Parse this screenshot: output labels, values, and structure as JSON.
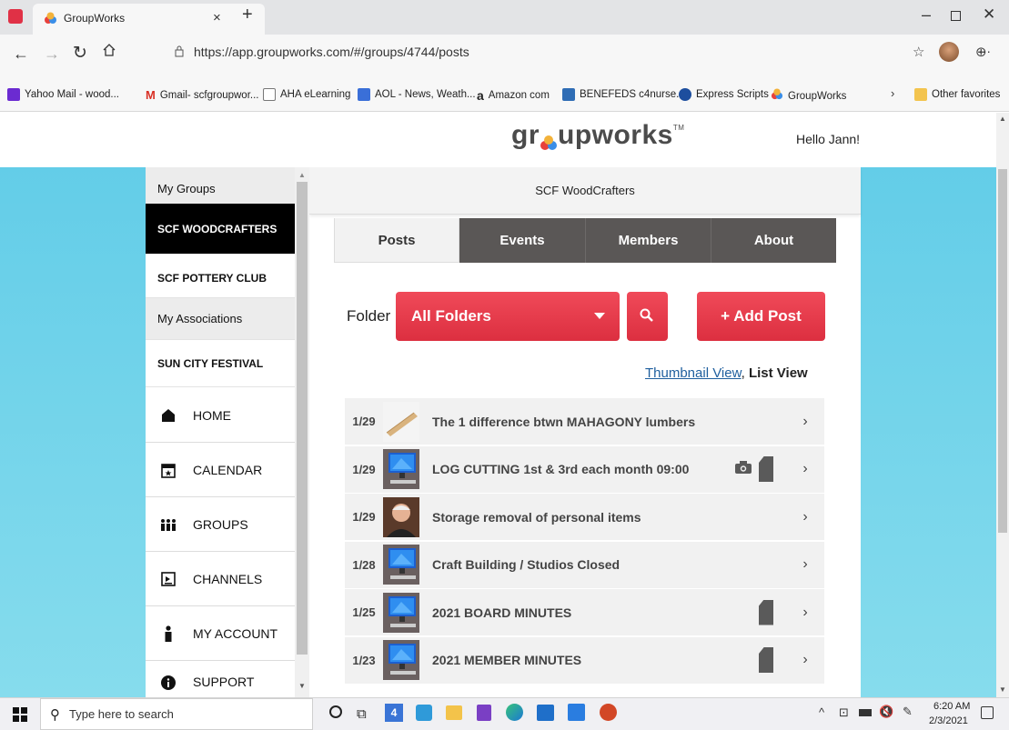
{
  "browser": {
    "tab_title": "GroupWorks",
    "url": "https://app.groupworks.com/#/groups/4744/posts",
    "favorites": [
      {
        "label": "Yahoo Mail - wood...",
        "color": "#6b2bd1"
      },
      {
        "label": "Gmail- scfgroupwor...",
        "color": "#d93025"
      },
      {
        "label": "AHA eLearning",
        "color": "#777777"
      },
      {
        "label": "AOL - News, Weath...",
        "color": "#3a6fd8"
      },
      {
        "label": "Amazon com",
        "color": "#111111"
      },
      {
        "label": "BENEFEDS c4nurse...",
        "color": "#2f6db5"
      },
      {
        "label": "Express Scripts",
        "color": "#1d4e9e"
      },
      {
        "label": "GroupWorks",
        "color": "#f2a33a"
      }
    ],
    "other_favorites": "Other favorites"
  },
  "header": {
    "logo_pre": "gr",
    "logo_post": "upworks",
    "logo_tm": "TM",
    "greeting": "Hello Jann!"
  },
  "sidebar": {
    "my_groups": "My Groups",
    "groups": [
      "SCF WOODCRAFTERS",
      "SCF POTTERY CLUB"
    ],
    "my_associations": "My Associations",
    "associations": [
      "SUN CITY FESTIVAL"
    ],
    "nav": [
      {
        "label": "HOME",
        "icon": "home-icon"
      },
      {
        "label": "CALENDAR",
        "icon": "calendar-icon"
      },
      {
        "label": "GROUPS",
        "icon": "groups-icon"
      },
      {
        "label": "CHANNELS",
        "icon": "channels-icon"
      },
      {
        "label": "MY ACCOUNT",
        "icon": "account-icon"
      },
      {
        "label": "SUPPORT",
        "icon": "info-icon"
      }
    ]
  },
  "main": {
    "group_title": "SCF WoodCrafters",
    "tabs": [
      "Posts",
      "Events",
      "Members",
      "About"
    ],
    "folder_label": "Folder",
    "folder_value": "All Folders",
    "add_post": "+ Add Post",
    "view_thumbnail": "Thumbnail View",
    "view_sep": ",",
    "view_list": "List View",
    "posts": [
      {
        "date": "1/29",
        "title": "The 1 difference btwn MAHAGONY lumbers",
        "thumb": "wood",
        "camera": false,
        "doc": false
      },
      {
        "date": "1/29",
        "title": "LOG CUTTING 1st & 3rd each month 09:00",
        "thumb": "computer",
        "camera": true,
        "doc": true
      },
      {
        "date": "1/29",
        "title": "Storage removal of personal items",
        "thumb": "person",
        "camera": false,
        "doc": false
      },
      {
        "date": "1/28",
        "title": "Craft Building / Studios Closed",
        "thumb": "computer",
        "camera": false,
        "doc": false
      },
      {
        "date": "1/25",
        "title": "2021 BOARD MINUTES",
        "thumb": "computer",
        "camera": false,
        "doc": true
      },
      {
        "date": "1/23",
        "title": "2021 MEMBER MINUTES",
        "thumb": "computer",
        "camera": false,
        "doc": true
      }
    ]
  },
  "taskbar": {
    "search_placeholder": "Type here to search",
    "time": "6:20 AM",
    "date": "2/3/2021",
    "calendar_day": "4"
  },
  "colors": {
    "accent_red": "#e9394a",
    "tab_dark": "#5a5756",
    "cyan": "#6fd3ea",
    "link": "#1f5f9e"
  }
}
